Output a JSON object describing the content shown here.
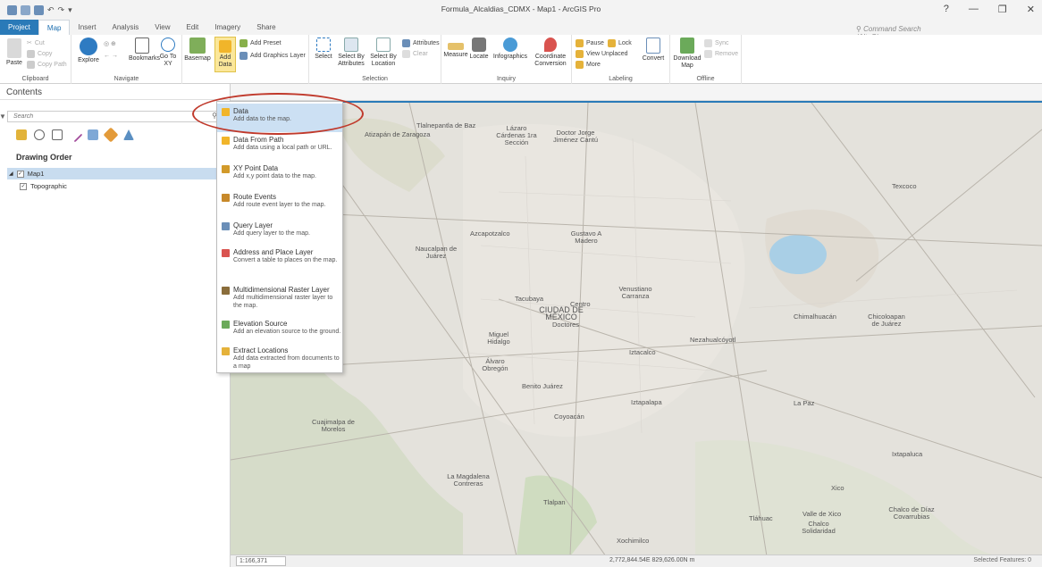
{
  "window": {
    "title": "Formula_Alcaldias_CDMX - Map1 - ArcGIS Pro",
    "command_search": "Command Search (Alt+Q)",
    "controls": [
      "?",
      "—",
      "❐",
      "✕"
    ]
  },
  "tabs": [
    "Project",
    "Map",
    "Insert",
    "Analysis",
    "View",
    "Edit",
    "Imagery",
    "Share"
  ],
  "ribbon": {
    "clipboard": {
      "label": "Clipboard",
      "paste": "Paste",
      "cut": "Cut",
      "copy": "Copy",
      "copy_path": "Copy Path"
    },
    "navigate": {
      "label": "Navigate",
      "explore": "Explore",
      "bookmarks": "Bookmarks",
      "go_to_xy": "Go To XY"
    },
    "layer": {
      "basemap": "Basemap",
      "add_data": "Add Data",
      "add_preset": "Add Preset",
      "add_graphics_layer": "Add Graphics Layer"
    },
    "selection": {
      "label": "Selection",
      "select": "Select",
      "select_by_attributes": "Select By Attributes",
      "select_by_location": "Select By Location",
      "attributes": "Attributes",
      "clear": "Clear"
    },
    "inquiry": {
      "label": "Inquiry",
      "measure": "Measure",
      "locate": "Locate",
      "infographics": "Infographics",
      "coordinate_conversion": "Coordinate Conversion"
    },
    "labeling": {
      "label": "Labeling",
      "pause": "Pause",
      "lock": "Lock",
      "view_unplaced": "View Unplaced",
      "more": "More",
      "convert": "Convert"
    },
    "offline": {
      "label": "Offline",
      "download_map": "Download Map",
      "sync": "Sync",
      "remove": "Remove"
    }
  },
  "contents": {
    "title": "Contents",
    "search_placeholder": "Search",
    "drawing_order": "Drawing Order",
    "map_item": "Map1",
    "layer_item": "Topographic"
  },
  "add_data_menu": [
    {
      "title": "Data",
      "desc": "Add data to the map."
    },
    {
      "title": "Data From Path",
      "desc": "Add data using a local path or URL."
    },
    {
      "title": "XY Point Data",
      "desc": "Add x,y point data to the map."
    },
    {
      "title": "Route Events",
      "desc": "Add route event layer to the map."
    },
    {
      "title": "Query Layer",
      "desc": "Add query layer to the map."
    },
    {
      "title": "Address and Place Layer",
      "desc": "Convert a table to places on the map."
    },
    {
      "title": "Multidimensional Raster Layer",
      "desc": "Add multidimensional raster layer to the map."
    },
    {
      "title": "Elevation Source",
      "desc": "Add an elevation source to the ground."
    },
    {
      "title": "Extract Locations",
      "desc": "Add data extracted from documents to a map"
    }
  ],
  "map_labels": {
    "tlalnepantla": "Tlalnepantla de Baz",
    "atizapan": "Atizapán de Zaragoza",
    "lazaro": "Lázaro Cárdenas 1ra Sección",
    "doctor": "Doctor Jorge Jiménez Cantú",
    "naucalpan": "Naucalpan de Juárez",
    "azcapotzalco": "Azcapotzalco",
    "gustavo": "Gustavo A Madero",
    "venustiano": "Venustiano Carranza",
    "ciudad": "CIUDAD DE MÉXICO",
    "tacubaya": "Tacubaya",
    "miguel": "Miguel Hidalgo",
    "alvaro": "Álvaro Obregón",
    "benito": "Benito Juárez",
    "nezahualcoyotl": "Nezahualcóyotl",
    "iztacalco": "Iztacalco",
    "iztapalapa": "Iztapalapa",
    "coyoacan": "Coyoacán",
    "cuajimalpa": "Cuajimalpa de Morelos",
    "magdalena": "La Magdalena Contreras",
    "tlalpan": "Tlalpan",
    "xochimilco": "Xochimilco",
    "tlahuac": "Tláhuac",
    "chimalhuacan": "Chimalhuacán",
    "chicoloapan": "Chicoloapan de Juárez",
    "lapaz": "La Paz",
    "ixtapaluca": "Ixtapaluca",
    "texcoco": "Texcoco",
    "valle": "Valle de Xico",
    "chalco": "Chalco Solidaridad",
    "chalco2": "Chalco de Díaz Covarrubias",
    "xico": "Xico",
    "centro": "Centro",
    "doctores": "Doctores"
  },
  "status": {
    "scale": "1:166,371",
    "coords": "2,772,844.54E 829,626.00N m",
    "selected": "Selected Features: 0"
  },
  "colors": {
    "accent": "#2a7ab8",
    "highlight": "#cce0f3",
    "oval": "#c0392b"
  }
}
